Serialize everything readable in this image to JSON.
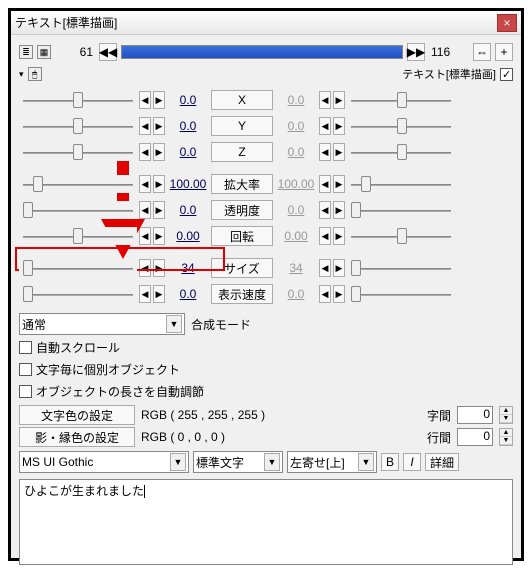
{
  "window": {
    "title": "テキスト[標準描画]"
  },
  "timeline": {
    "start": "61",
    "end": "116",
    "sub_label": "テキスト[標準描画]"
  },
  "params": [
    {
      "name": "X",
      "lval": "0.0",
      "rval": "0.0",
      "lthumb": 54,
      "rthumb": 50,
      "dimr": true
    },
    {
      "name": "Y",
      "lval": "0.0",
      "rval": "0.0",
      "lthumb": 54,
      "rthumb": 50,
      "dimr": true
    },
    {
      "name": "Z",
      "lval": "0.0",
      "rval": "0.0",
      "lthumb": 54,
      "rthumb": 50,
      "dimr": true
    },
    {
      "name": "拡大率",
      "lval": "100.00",
      "rval": "100.00",
      "lthumb": 14,
      "rthumb": 14,
      "dimr": true
    },
    {
      "name": "透明度",
      "lval": "0.0",
      "rval": "0.0",
      "lthumb": 4,
      "rthumb": 4,
      "dimr": true
    },
    {
      "name": "回転",
      "lval": "0.00",
      "rval": "0.00",
      "lthumb": 54,
      "rthumb": 50,
      "dimr": true
    },
    {
      "name": "サイズ",
      "lval": "34",
      "rval": "34",
      "lthumb": 4,
      "rthumb": 4,
      "dimr": true,
      "highlight": true
    },
    {
      "name": "表示速度",
      "lval": "0.0",
      "rval": "0.0",
      "lthumb": 4,
      "rthumb": 4,
      "dimr": true
    }
  ],
  "blend": {
    "combo": "通常",
    "label": "合成モード"
  },
  "checks": {
    "autoscroll": "自動スクロール",
    "per_char": "文字毎に個別オブジェクト",
    "auto_len": "オブジェクトの長さを自動調節"
  },
  "color": {
    "text_btn": "文字色の設定",
    "shadow_btn": "影・縁色の設定",
    "text_rgb": "RGB ( 255 , 255 , 255 )",
    "shadow_rgb": "RGB ( 0 , 0 , 0 )",
    "spacing_label": "字間",
    "line_label": "行間",
    "spacing_val": "0",
    "line_val": "0"
  },
  "font": {
    "name": "MS UI Gothic",
    "style": "標準文字",
    "align": "左寄せ[上]",
    "b": "B",
    "i": "I",
    "detail": "詳細"
  },
  "text_input": "ひよこが生まれました"
}
